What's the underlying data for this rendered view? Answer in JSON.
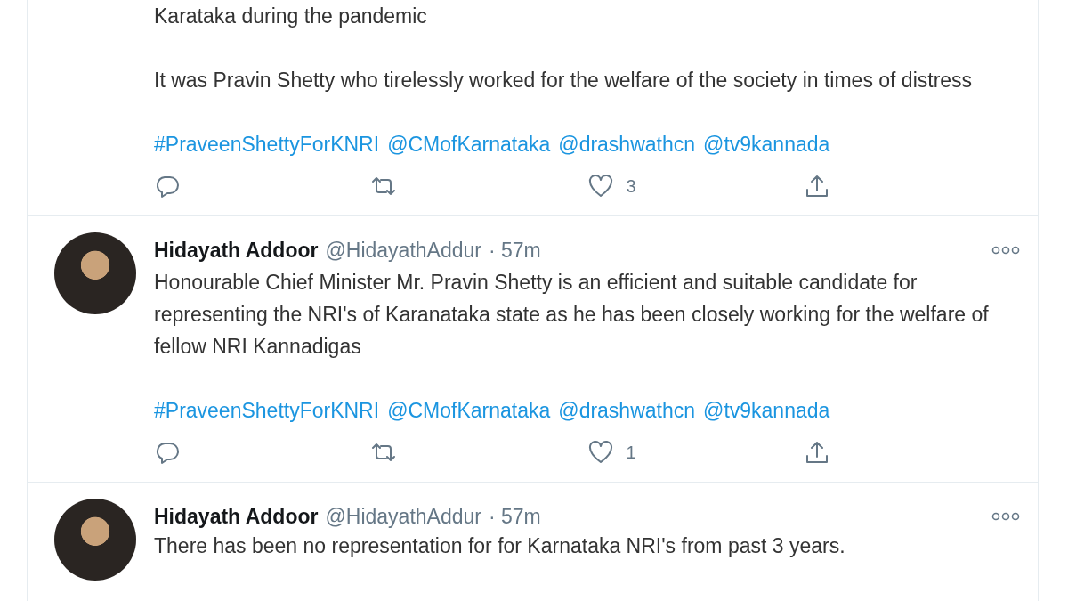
{
  "tweets": [
    {
      "paragraphs": [
        "Karataka during the pandemic",
        "It was Pravin Shetty who tirelessly worked for the welfare of the society in times of distress"
      ],
      "links": [
        "#PraveenShettyForKNRI",
        "@CMofKarnataka",
        "@drashwathcn",
        "@tv9kannada"
      ],
      "likes": "3"
    },
    {
      "author": {
        "name": "Hidayath Addoor",
        "handle": "@HidayathAddur",
        "time": "· 57m"
      },
      "paragraphs": [
        "Honourable Chief Minister Mr. Pravin Shetty is an efficient and suitable candidate for representing the NRI's of Karanataka state as he has been closely working for the welfare of fellow NRI Kannadigas"
      ],
      "links": [
        "#PraveenShettyForKNRI",
        "@CMofKarnataka",
        "@drashwathcn",
        "@tv9kannada"
      ],
      "likes": "1"
    },
    {
      "author": {
        "name": "Hidayath Addoor",
        "handle": "@HidayathAddur",
        "time": "· 57m"
      },
      "paragraphs": [
        "There has been no representation for for Karnataka NRI's from past 3 years."
      ]
    }
  ]
}
